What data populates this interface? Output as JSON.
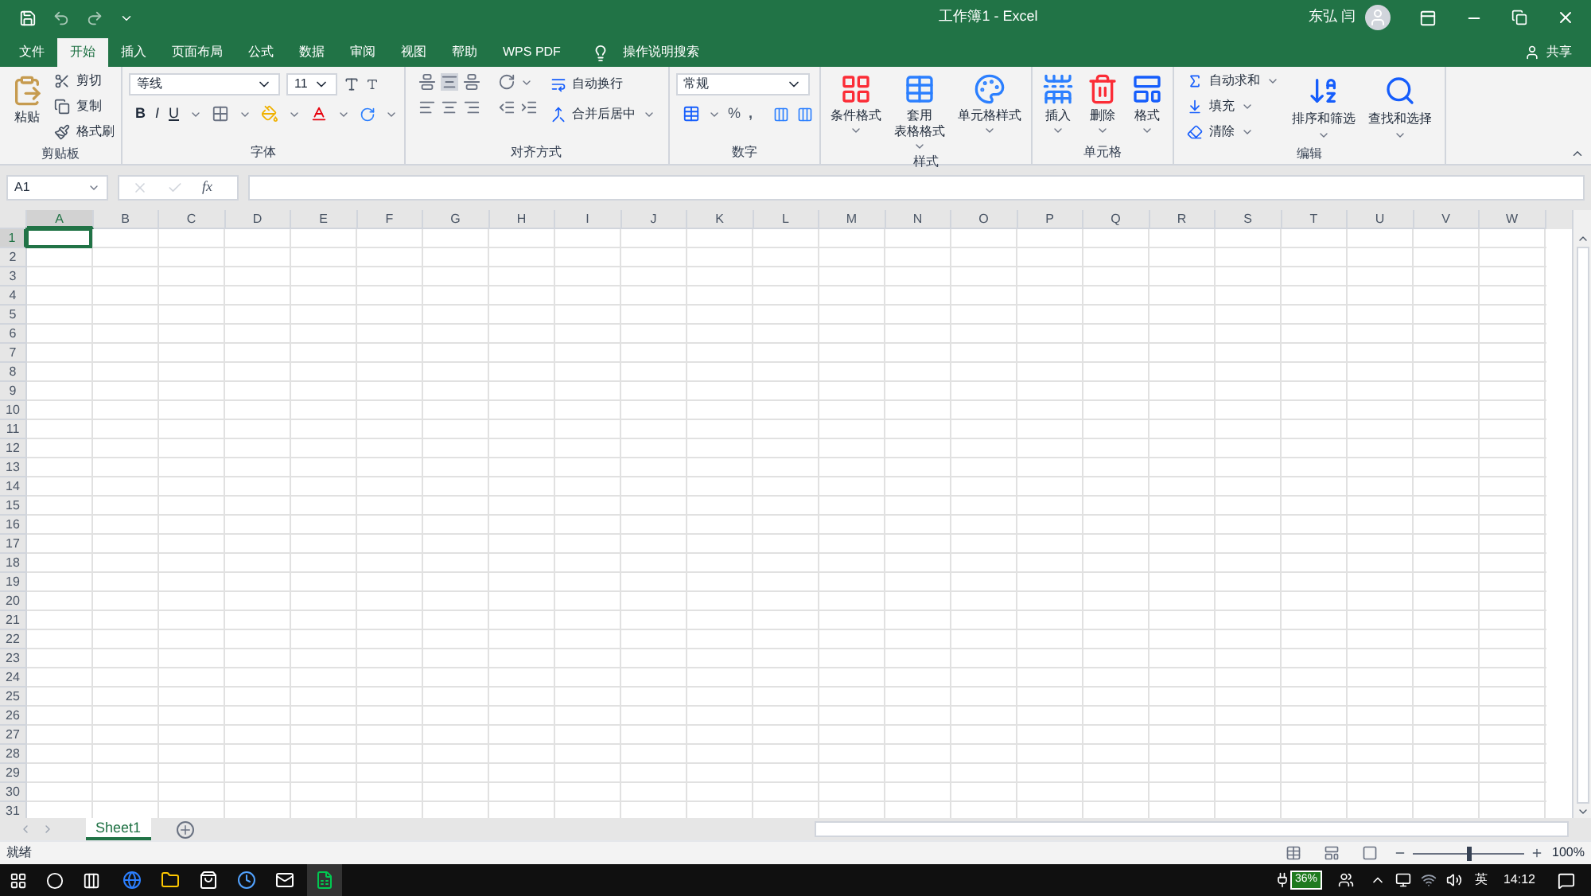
{
  "title_bar": {
    "title": "工作簿1 - Excel",
    "user": "东弘 闫"
  },
  "tabs": [
    {
      "label": "文件",
      "selected": false
    },
    {
      "label": "开始",
      "selected": true
    },
    {
      "label": "插入",
      "selected": false
    },
    {
      "label": "页面布局",
      "selected": false
    },
    {
      "label": "公式",
      "selected": false
    },
    {
      "label": "数据",
      "selected": false
    },
    {
      "label": "审阅",
      "selected": false
    },
    {
      "label": "视图",
      "selected": false
    },
    {
      "label": "帮助",
      "selected": false
    },
    {
      "label": "WPS PDF",
      "selected": false
    }
  ],
  "tell_me": "操作说明搜索",
  "share": "共享",
  "ribbon": [
    {
      "kind": "clipboard",
      "label": "剪贴板",
      "paste": "粘贴",
      "items": [
        "剪切",
        "复制",
        "格式刷"
      ]
    },
    {
      "kind": "font",
      "label": "字体",
      "font_name": "等线",
      "font_size": "11",
      "bold": "B",
      "italic": "I",
      "underline": "U"
    },
    {
      "kind": "alignment",
      "label": "对齐方式",
      "wrap": "自动换行",
      "merge": "合并后居中"
    },
    {
      "kind": "number",
      "label": "数字",
      "format": "常规",
      "percent": "%",
      "comma": ","
    },
    {
      "kind": "large",
      "label": "样式",
      "buttons": [
        [
          "条件格式"
        ],
        [
          "套用",
          "表格格式"
        ],
        [
          "单元格样式"
        ]
      ]
    },
    {
      "kind": "large",
      "label": "单元格",
      "buttons": [
        [
          "插入"
        ],
        [
          "删除"
        ],
        [
          "格式"
        ]
      ]
    },
    {
      "kind": "editing",
      "label": "编辑",
      "small": [
        "自动求和",
        "填充",
        "清除"
      ],
      "large": [
        "排序和筛选",
        "查找和选择"
      ]
    }
  ],
  "name_box": "A1",
  "fx": "fx",
  "columns": [
    {
      "label": "A",
      "selected": true
    },
    {
      "label": "B",
      "selected": false
    },
    {
      "label": "C",
      "selected": false
    },
    {
      "label": "D",
      "selected": false
    },
    {
      "label": "E",
      "selected": false
    },
    {
      "label": "F",
      "selected": false
    },
    {
      "label": "G",
      "selected": false
    },
    {
      "label": "H",
      "selected": false
    },
    {
      "label": "I",
      "selected": false
    },
    {
      "label": "J",
      "selected": false
    },
    {
      "label": "K",
      "selected": false
    },
    {
      "label": "L",
      "selected": false
    },
    {
      "label": "M",
      "selected": false
    },
    {
      "label": "N",
      "selected": false
    },
    {
      "label": "O",
      "selected": false
    },
    {
      "label": "P",
      "selected": false
    },
    {
      "label": "Q",
      "selected": false
    },
    {
      "label": "R",
      "selected": false
    },
    {
      "label": "S",
      "selected": false
    },
    {
      "label": "T",
      "selected": false
    },
    {
      "label": "U",
      "selected": false
    },
    {
      "label": "V",
      "selected": false
    },
    {
      "label": "W",
      "selected": false
    }
  ],
  "rows": [
    {
      "label": "1",
      "selected": true
    },
    {
      "label": "2",
      "selected": false
    },
    {
      "label": "3",
      "selected": false
    },
    {
      "label": "4",
      "selected": false
    },
    {
      "label": "5",
      "selected": false
    },
    {
      "label": "6",
      "selected": false
    },
    {
      "label": "7",
      "selected": false
    },
    {
      "label": "8",
      "selected": false
    },
    {
      "label": "9",
      "selected": false
    },
    {
      "label": "10",
      "selected": false
    },
    {
      "label": "11",
      "selected": false
    },
    {
      "label": "12",
      "selected": false
    },
    {
      "label": "13",
      "selected": false
    },
    {
      "label": "14",
      "selected": false
    },
    {
      "label": "15",
      "selected": false
    },
    {
      "label": "16",
      "selected": false
    },
    {
      "label": "17",
      "selected": false
    },
    {
      "label": "18",
      "selected": false
    },
    {
      "label": "19",
      "selected": false
    },
    {
      "label": "20",
      "selected": false
    },
    {
      "label": "21",
      "selected": false
    },
    {
      "label": "22",
      "selected": false
    },
    {
      "label": "23",
      "selected": false
    },
    {
      "label": "24",
      "selected": false
    },
    {
      "label": "25",
      "selected": false
    },
    {
      "label": "26",
      "selected": false
    },
    {
      "label": "27",
      "selected": false
    },
    {
      "label": "28",
      "selected": false
    },
    {
      "label": "29",
      "selected": false
    },
    {
      "label": "30",
      "selected": false
    },
    {
      "label": "31",
      "selected": false
    }
  ],
  "sheets": [
    {
      "label": "Sheet1",
      "selected": true
    }
  ],
  "status": "就绪",
  "zoom_slider": {
    "level": 0.5
  },
  "zoom": "100%",
  "taskbar": {
    "battery": "36%",
    "ime": "英",
    "time": "14:12"
  }
}
